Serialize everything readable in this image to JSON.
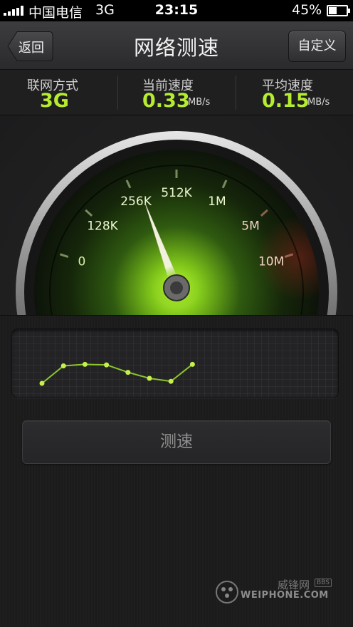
{
  "status_bar": {
    "carrier": "中国电信",
    "network": "3G",
    "time": "23:15",
    "battery_text": "45%",
    "battery_level": 0.45
  },
  "title_bar": {
    "back_label": "返回",
    "title": "网络测速",
    "custom_label": "自定义"
  },
  "stats": {
    "connection_label": "联网方式",
    "connection_value": "3G",
    "current_label": "当前速度",
    "current_value": "0.33",
    "current_unit": "MB/s",
    "average_label": "平均速度",
    "average_value": "0.15",
    "average_unit": "MB/s"
  },
  "gauge": {
    "scale_labels": [
      "0",
      "128K",
      "256K",
      "512K",
      "1M",
      "5M",
      "10M"
    ],
    "needle_position": 2.15,
    "accent": "#b6ec2f"
  },
  "speed_history": {
    "values": [
      0.2,
      0.55,
      0.58,
      0.57,
      0.42,
      0.3,
      0.24,
      0.58
    ],
    "line_color": "#8bc62a",
    "point_color": "#c8f04c"
  },
  "test_button_label": "测速",
  "watermark": {
    "cn": "威锋网",
    "bbs": "BBS",
    "en": "WEIPHONE.COM"
  }
}
